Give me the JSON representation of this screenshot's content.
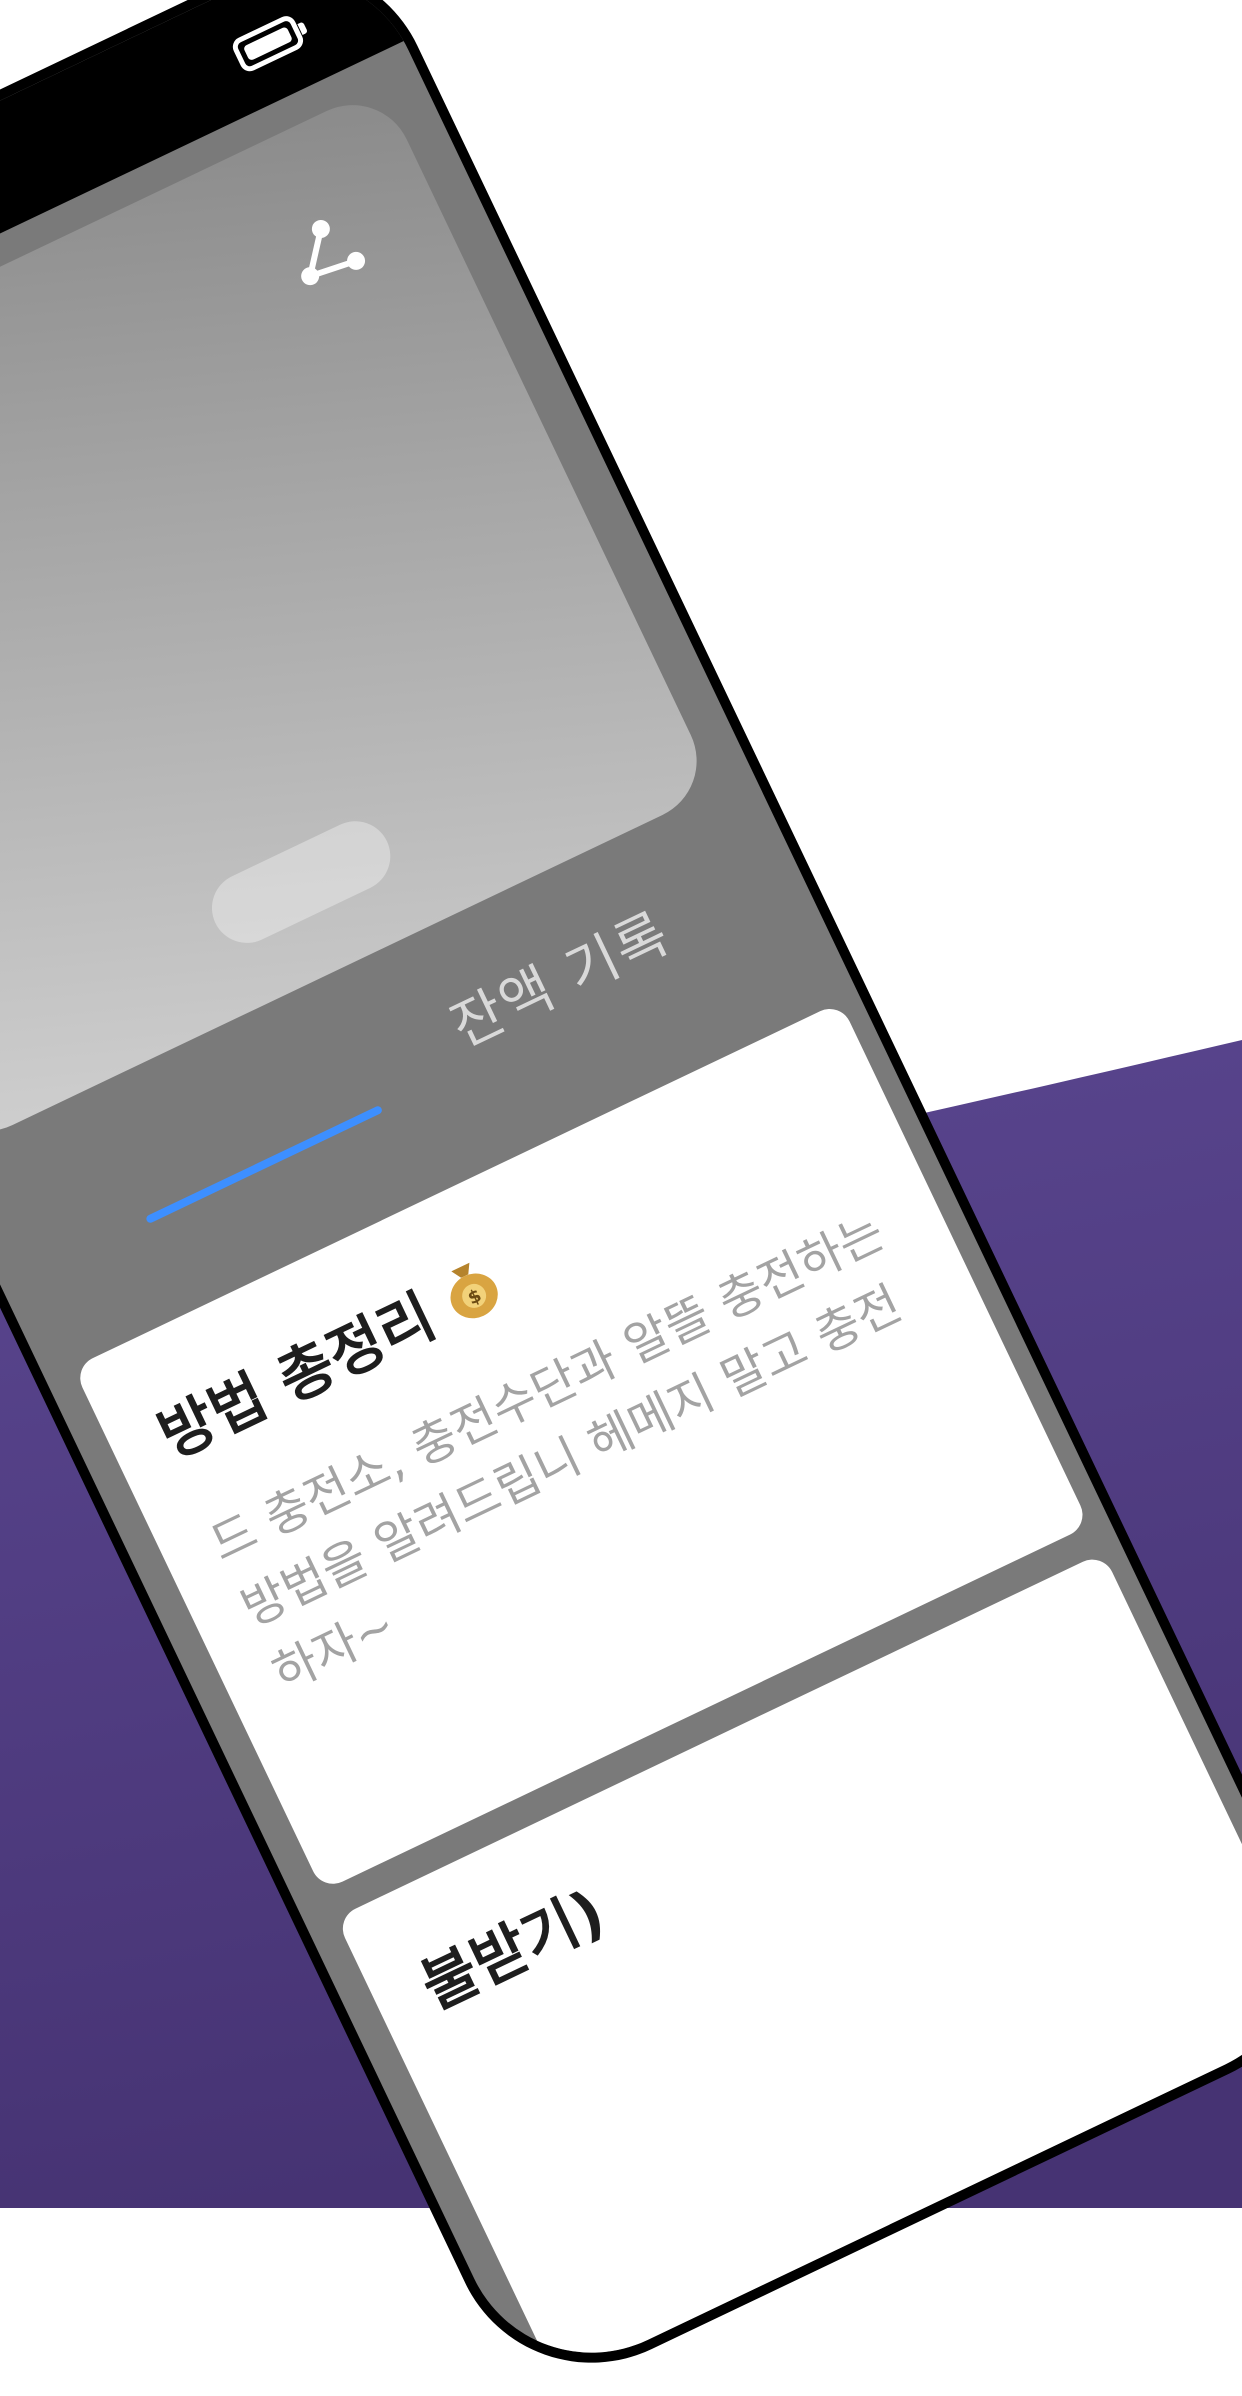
{
  "colors": {
    "page_background": "#ffffff",
    "accent_purple": "#4e3a86",
    "phone_screen": "#7a7a7a",
    "tab_indicator": "#3d8fff",
    "card_background": "#ffffff",
    "body_text": "#a3a3a3"
  },
  "status_bar": {
    "icons": [
      "battery-icon"
    ]
  },
  "hero_card": {
    "icons": [
      "share-icon"
    ]
  },
  "tabs": [
    {
      "label": "잔액 기록",
      "icon": null
    }
  ],
  "posts": [
    {
      "title": "방법 총정리",
      "title_icon": "money-bag-icon",
      "body": "드 충전소, 충전수단과 알뜰 충전하는 방법을 알려드립니 헤메지 말고 충전하자~"
    },
    {
      "title": "불받기)",
      "body": ""
    }
  ]
}
